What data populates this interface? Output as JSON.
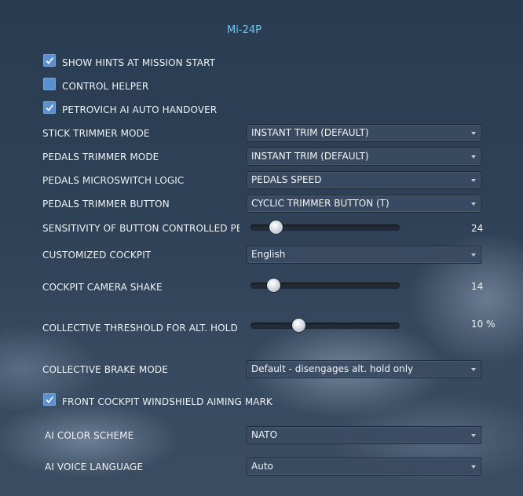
{
  "title": "Mi-24P",
  "checkboxes": {
    "show_hints": {
      "label": "SHOW HINTS AT MISSION START",
      "checked": true
    },
    "control_helper": {
      "label": "CONTROL HELPER",
      "checked": false
    },
    "petrovich": {
      "label": "PETROVICH AI AUTO HANDOVER",
      "checked": true
    },
    "windshield": {
      "label": "FRONT COCKPIT WINDSHIELD AIMING MARK",
      "checked": true
    }
  },
  "dropdowns": {
    "stick_trimmer": {
      "label": "STICK TRIMMER MODE",
      "value": "INSTANT TRIM (DEFAULT)"
    },
    "pedals_trimmer": {
      "label": "PEDALS TRIMMER MODE",
      "value": "INSTANT TRIM (DEFAULT)"
    },
    "pedals_microswitch": {
      "label": "PEDALS MICROSWITCH LOGIC",
      "value": "PEDALS SPEED"
    },
    "pedals_button": {
      "label": "PEDALS TRIMMER BUTTON",
      "value": "CYCLIC TRIMMER BUTTON (T)"
    },
    "cockpit": {
      "label": "CUSTOMIZED COCKPIT",
      "value": "English"
    },
    "brake": {
      "label": "COLLECTIVE BRAKE MODE",
      "value": "Default - disengages alt. hold only"
    },
    "color_scheme": {
      "label": "AI COLOR SCHEME",
      "value": "NATO"
    },
    "voice": {
      "label": "AI VOICE LANGUAGE",
      "value": "Auto"
    }
  },
  "sliders": {
    "sensitivity": {
      "label": "SENSITIVITY OF BUTTON CONTROLLED PEDALS",
      "value": "24",
      "fraction": 0.17
    },
    "shake": {
      "label": "COCKPIT CAMERA SHAKE",
      "value": "14",
      "fraction": 0.15
    },
    "threshold": {
      "label": "COLLECTIVE THRESHOLD FOR ALT. HOLD",
      "value": "10",
      "unit": "%",
      "fraction": 0.32
    }
  },
  "colors": {
    "accent": "#6ec8f0",
    "checkbox": "#5b8fcf"
  }
}
